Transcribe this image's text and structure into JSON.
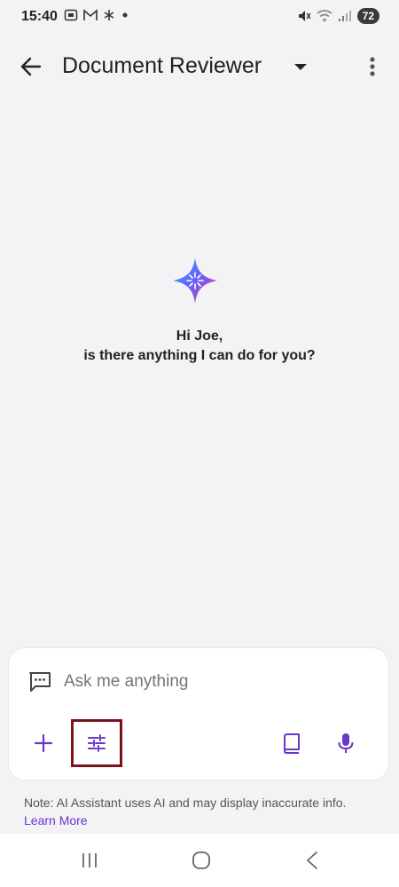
{
  "status_bar": {
    "time": "15:40",
    "battery": "72",
    "icons": [
      "screenshot-icon",
      "gmail-icon",
      "asterisk-icon",
      "dot-icon",
      "mute-icon",
      "wifi-icon",
      "signal-icon"
    ]
  },
  "app_bar": {
    "title": "Document Reviewer"
  },
  "greeting": {
    "line1": "Hi Joe,",
    "line2": "is there anything I can do for you?"
  },
  "composer": {
    "placeholder": "Ask me anything"
  },
  "note": {
    "text": "Note: AI Assistant uses AI and may display inaccurate info. ",
    "link": "Learn More"
  },
  "colors": {
    "accent": "#6a37c9",
    "highlight_box": "#7a1218",
    "background": "#f3f3f6"
  }
}
